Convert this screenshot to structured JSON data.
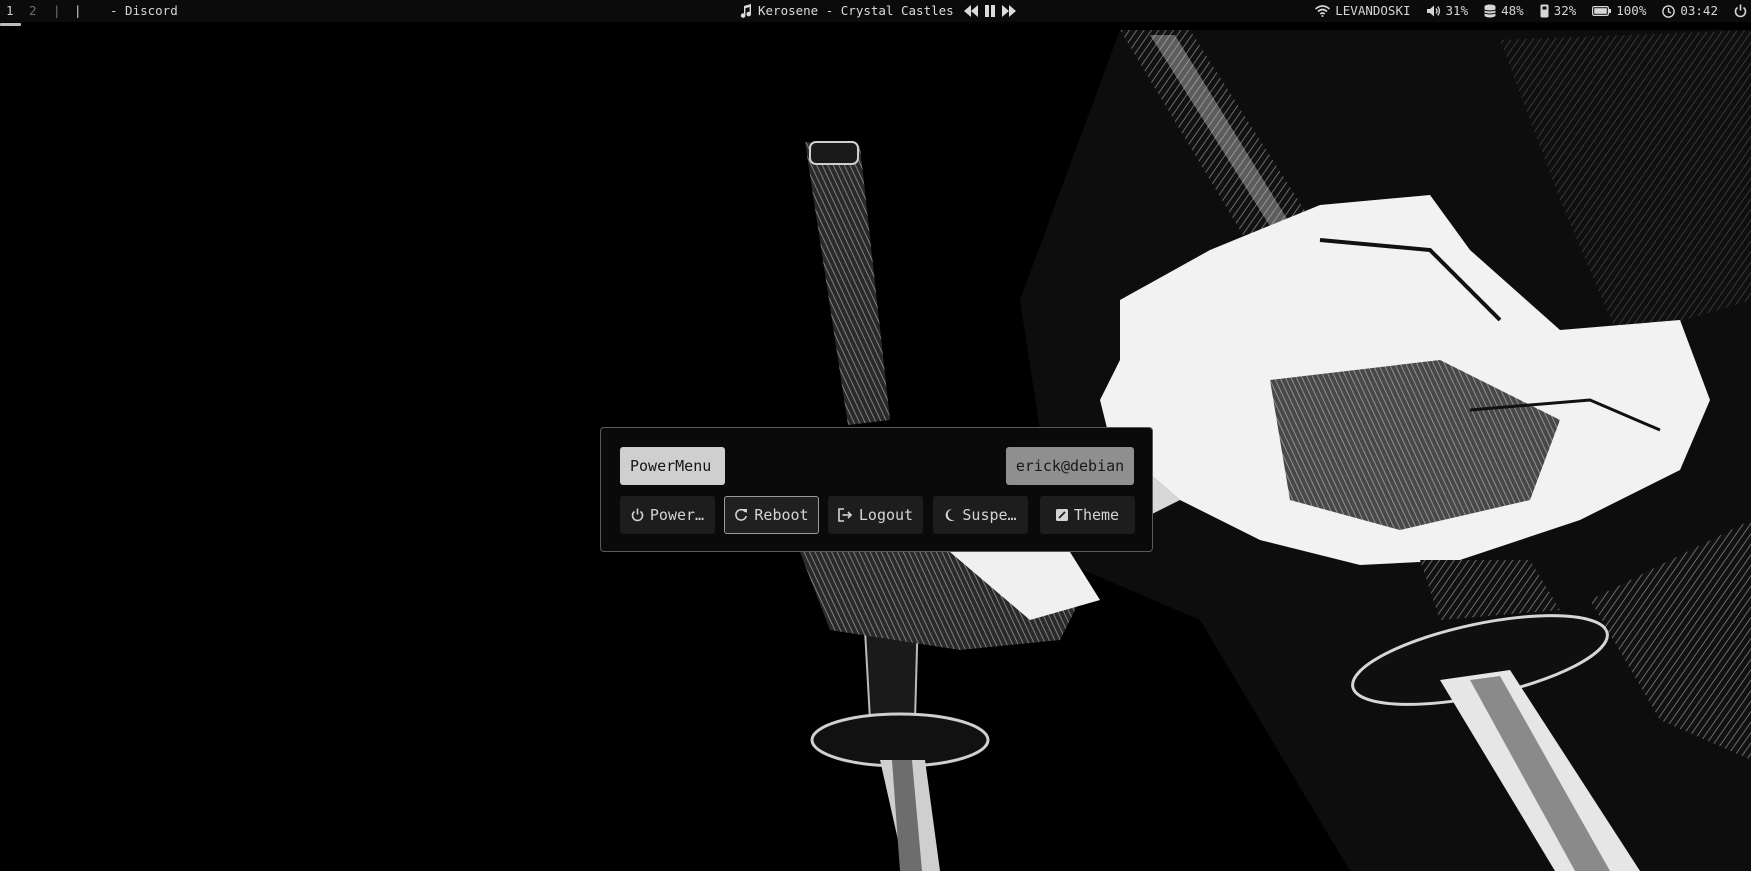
{
  "topbar": {
    "workspaces": [
      {
        "label": "1",
        "active": true
      },
      {
        "label": "2",
        "active": false
      },
      {
        "label": "|",
        "active": false
      },
      {
        "label": "|",
        "active": false
      }
    ],
    "window_title": "- Discord",
    "media": {
      "icon": "music-note-icon",
      "track": "Kerosene - Crystal Castles",
      "controls": [
        "previous-icon",
        "pause-icon",
        "next-icon"
      ]
    },
    "status": {
      "wifi": {
        "icon": "wifi-icon",
        "label": "LEVANDOSKI"
      },
      "volume": {
        "icon": "volume-icon",
        "value": "31%"
      },
      "disk": {
        "icon": "disk-icon",
        "value": "48%"
      },
      "memory": {
        "icon": "memory-icon",
        "value": "32%"
      },
      "battery": {
        "icon": "battery-icon",
        "value": "100%"
      },
      "clock": {
        "icon": "clock-icon",
        "value": "03:42"
      },
      "power": {
        "icon": "power-icon"
      }
    }
  },
  "powermenu": {
    "title": "PowerMenu",
    "user": "erick@debian",
    "buttons": [
      {
        "icon": "power-icon",
        "label": "Power…",
        "active": false
      },
      {
        "icon": "reboot-icon",
        "label": "Reboot",
        "active": true
      },
      {
        "icon": "logout-icon",
        "label": "Logout",
        "active": false
      },
      {
        "icon": "moon-icon",
        "label": "Suspe…",
        "active": false
      },
      {
        "icon": "theme-icon",
        "label": "Theme",
        "active": false
      }
    ]
  },
  "colors": {
    "bar_bg": "#0b0b0b",
    "menu_bg": "#0a0a0a",
    "menu_border": "#5a5a5a",
    "title_chip": "#cfcfcf",
    "user_chip": "#8f8f8f",
    "button_bg": "#1d1d1d"
  }
}
